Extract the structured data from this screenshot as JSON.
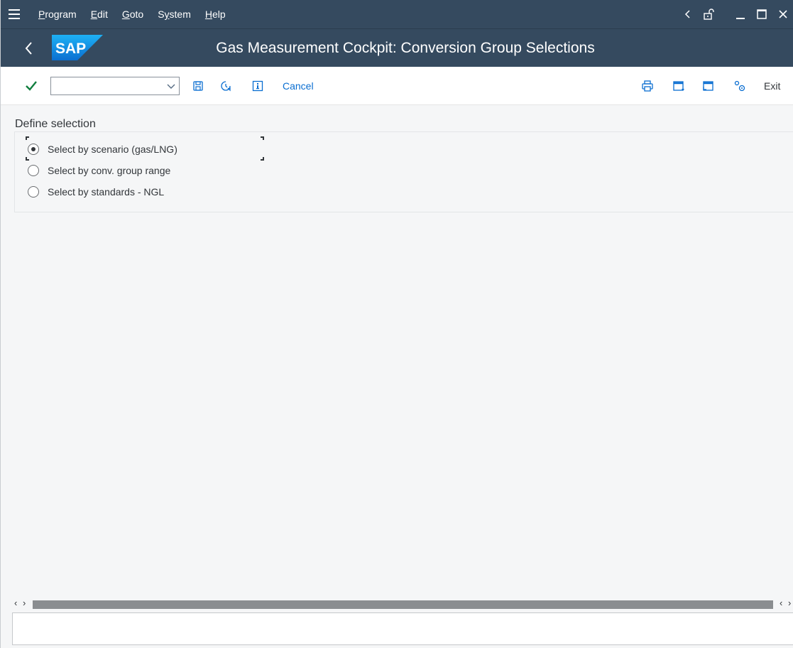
{
  "menubar": {
    "items": [
      {
        "prefix": "",
        "mnemonic": "P",
        "rest": "rogram"
      },
      {
        "prefix": "",
        "mnemonic": "E",
        "rest": "dit"
      },
      {
        "prefix": "",
        "mnemonic": "G",
        "rest": "oto"
      },
      {
        "prefix": "S",
        "mnemonic": "y",
        "rest": "stem"
      },
      {
        "prefix": "",
        "mnemonic": "H",
        "rest": "elp"
      }
    ]
  },
  "titlebar": {
    "logo_text": "SAP",
    "title": "Gas Measurement Cockpit: Conversion Group Selections"
  },
  "toolbar": {
    "command_value": "",
    "cancel_label": "Cancel",
    "exit_label": "Exit"
  },
  "selection": {
    "heading": "Define selection",
    "options": [
      {
        "label": "Select by scenario (gas/LNG)",
        "selected": true
      },
      {
        "label": "Select by conv. group range",
        "selected": false
      },
      {
        "label": "Select by standards - NGL",
        "selected": false
      }
    ]
  },
  "colors": {
    "shell": "#354a5f",
    "accent": "#0a6ed1",
    "check": "#107e3e",
    "background": "#f5f6f7"
  },
  "icons": [
    "hamburger-icon",
    "back-icon",
    "unlock-icon",
    "minimize-icon",
    "maximize-icon",
    "close-icon",
    "checkmark-icon",
    "chevron-down-icon",
    "save-icon",
    "history-icon",
    "info-icon",
    "print-icon",
    "window-icon",
    "window-export-icon",
    "settings-icon"
  ]
}
